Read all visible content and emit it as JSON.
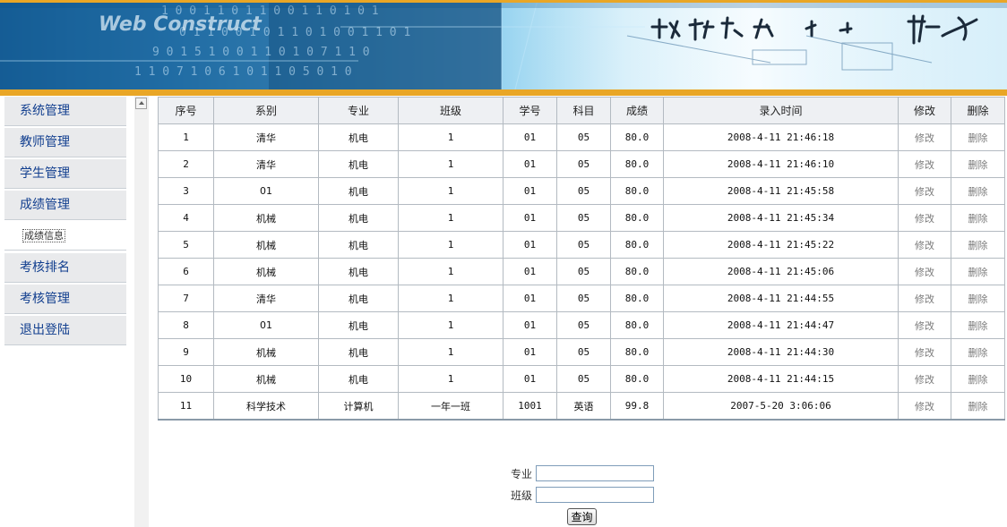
{
  "sidebar": {
    "items": [
      {
        "label": "系统管理"
      },
      {
        "label": "教师管理"
      },
      {
        "label": "学生管理"
      },
      {
        "label": "成绩管理"
      },
      {
        "label": "成绩信息"
      },
      {
        "label": "考核排名"
      },
      {
        "label": "考核管理"
      },
      {
        "label": "退出登陆"
      }
    ]
  },
  "table": {
    "headers": [
      "序号",
      "系别",
      "专业",
      "班级",
      "学号",
      "科目",
      "成绩",
      "录入时间",
      "修改",
      "删除"
    ],
    "rows": [
      [
        "1",
        "清华",
        "机电",
        "1",
        "01",
        "05",
        "80.0",
        "2008-4-11 21:46:18",
        "修改",
        "删除"
      ],
      [
        "2",
        "清华",
        "机电",
        "1",
        "01",
        "05",
        "80.0",
        "2008-4-11 21:46:10",
        "修改",
        "删除"
      ],
      [
        "3",
        "01",
        "机电",
        "1",
        "01",
        "05",
        "80.0",
        "2008-4-11 21:45:58",
        "修改",
        "删除"
      ],
      [
        "4",
        "机械",
        "机电",
        "1",
        "01",
        "05",
        "80.0",
        "2008-4-11 21:45:34",
        "修改",
        "删除"
      ],
      [
        "5",
        "机械",
        "机电",
        "1",
        "01",
        "05",
        "80.0",
        "2008-4-11 21:45:22",
        "修改",
        "删除"
      ],
      [
        "6",
        "机械",
        "机电",
        "1",
        "01",
        "05",
        "80.0",
        "2008-4-11 21:45:06",
        "修改",
        "删除"
      ],
      [
        "7",
        "清华",
        "机电",
        "1",
        "01",
        "05",
        "80.0",
        "2008-4-11 21:44:55",
        "修改",
        "删除"
      ],
      [
        "8",
        "01",
        "机电",
        "1",
        "01",
        "05",
        "80.0",
        "2008-4-11 21:44:47",
        "修改",
        "删除"
      ],
      [
        "9",
        "机械",
        "机电",
        "1",
        "01",
        "05",
        "80.0",
        "2008-4-11 21:44:30",
        "修改",
        "删除"
      ],
      [
        "10",
        "机械",
        "机电",
        "1",
        "01",
        "05",
        "80.0",
        "2008-4-11 21:44:15",
        "修改",
        "删除"
      ],
      [
        "11",
        "科学技术",
        "计算机",
        "一年一班",
        "1001",
        "英语",
        "99.8",
        "2007-5-20 3:06:06",
        "修改",
        "删除"
      ]
    ]
  },
  "search": {
    "major_label": "专业",
    "major_value": "",
    "class_label": "班级",
    "class_value": "",
    "query_button": "查询"
  },
  "colors": {
    "accent_orange": "#e9a626",
    "sidebar_text": "#123f8f",
    "sidebar_bg": "#e9eaec"
  }
}
